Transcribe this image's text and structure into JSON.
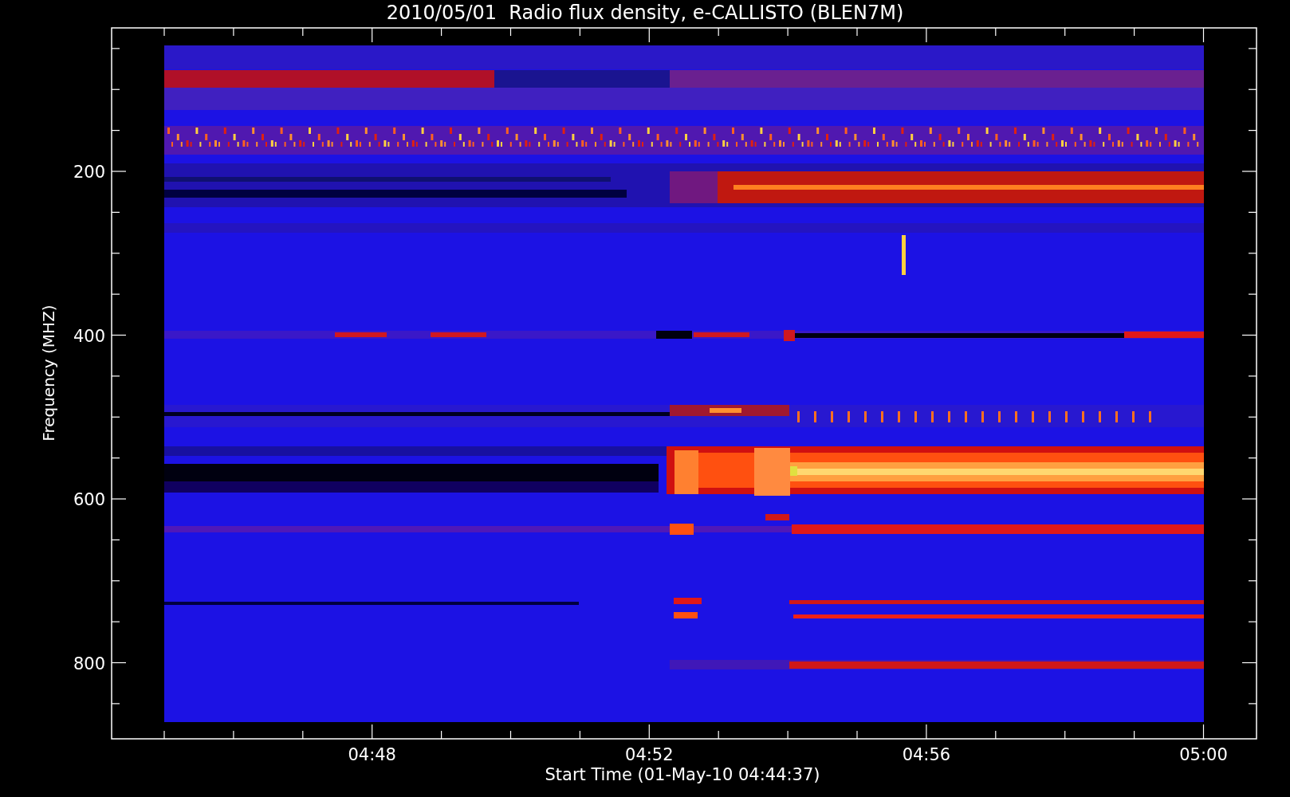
{
  "title": "2010/05/01  Radio flux density, e-CALLISTO (BLEN7M)",
  "y_axis": {
    "label": "Frequency (MHZ)",
    "ticks": [
      "200",
      "400",
      "600",
      "800"
    ]
  },
  "x_axis": {
    "label": "Start Time (01-May-10 04:44:37)",
    "ticks": [
      "04:48",
      "04:52",
      "04:56",
      "05:00"
    ]
  }
}
